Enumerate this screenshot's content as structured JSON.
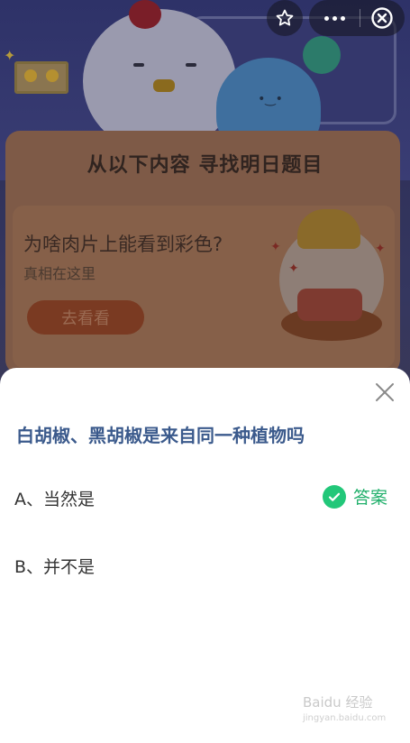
{
  "background": {
    "card_title": "从以下内容 寻找明日题目",
    "question": "为啥肉片上能看到彩色?",
    "subtitle": "真相在这里",
    "button_label": "去看看"
  },
  "capsule": {
    "star_icon": "star-outline-icon",
    "more_icon": "more-dots-icon",
    "close_icon": "close-circle-icon"
  },
  "sheet": {
    "question": "白胡椒、黑胡椒是来自同一种植物吗",
    "options": [
      {
        "label": "A、当然是",
        "is_answer": true
      },
      {
        "label": "B、并不是",
        "is_answer": false
      }
    ],
    "answer_label": "答案",
    "answer_color": "#22c779"
  },
  "watermark": {
    "text": "Baidu 经验",
    "sub": "jingyan.baidu.com"
  }
}
